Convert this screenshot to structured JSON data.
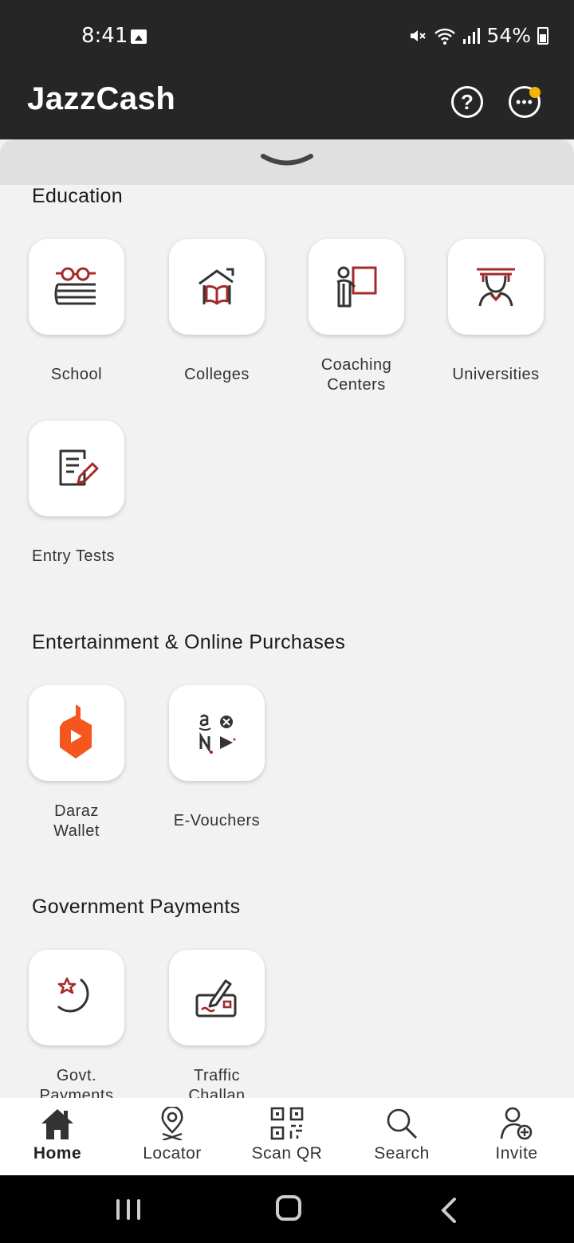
{
  "status_bar": {
    "time": "8:41",
    "battery": "54%"
  },
  "header": {
    "title": "JazzCash",
    "help_symbol": "?",
    "more_symbol": "•••"
  },
  "colors": {
    "accent": "#a52a2a",
    "header_bg": "#262626",
    "notif": "#f5b400",
    "daraz": "#f5561d"
  },
  "sections": [
    {
      "title": "Education",
      "items": [
        {
          "label": "School",
          "icon": "school-icon"
        },
        {
          "label": "Colleges",
          "icon": "college-icon"
        },
        {
          "label": "Coaching Centers",
          "label_l1": "Coaching",
          "label_l2": "Centers",
          "icon": "coaching-icon"
        },
        {
          "label": "Universities",
          "icon": "university-icon"
        },
        {
          "label": "Entry Tests",
          "icon": "entry-test-icon"
        }
      ]
    },
    {
      "title": "Entertainment & Online Purchases",
      "items": [
        {
          "label": "Daraz Wallet",
          "label_l1": "Daraz",
          "label_l2": "Wallet",
          "icon": "daraz-icon"
        },
        {
          "label": "E-Vouchers",
          "icon": "evouchers-icon"
        }
      ]
    },
    {
      "title": "Government Payments",
      "items": [
        {
          "label": "Govt. Payments",
          "label_l1": "Govt.",
          "label_l2": "Payments",
          "icon": "govt-payments-icon"
        },
        {
          "label": "Traffic Challan",
          "label_l1": "Traffic",
          "label_l2": "Challan",
          "icon": "traffic-challan-icon"
        }
      ]
    }
  ],
  "bottom_nav": [
    {
      "label": "Home",
      "icon": "home-icon",
      "active": true
    },
    {
      "label": "Locator",
      "icon": "location-pin-icon"
    },
    {
      "label": "Scan QR",
      "icon": "qr-code-icon"
    },
    {
      "label": "Search",
      "icon": "search-icon"
    },
    {
      "label": "Invite",
      "icon": "add-user-icon"
    }
  ]
}
